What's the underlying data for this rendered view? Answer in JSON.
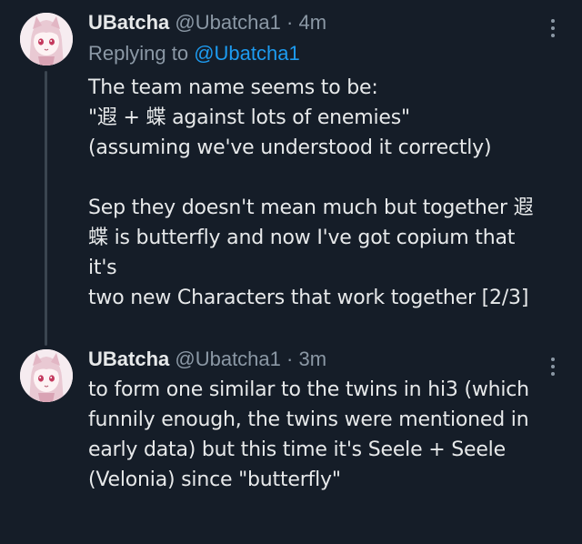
{
  "tweets": [
    {
      "name": "UBatcha",
      "handle": "@Ubatcha1",
      "separator": "·",
      "time": "4m",
      "replying_prefix": "Replying to",
      "replying_to": "@Ubatcha1",
      "paragraph1": "The team name seems to be:\n\"遐 + 蝶 against lots of enemies\"\n(assuming we've understood it correctly)",
      "paragraph2": "Sep they doesn't mean much but together 遐\n蝶 is butterfly and now I've got copium that it's\ntwo new Characters that work together [2/3]"
    },
    {
      "name": "UBatcha",
      "handle": "@Ubatcha1",
      "separator": "·",
      "time": "3m",
      "text": "to form one similar to the twins in hi3 (which\nfunnily enough, the twins were mentioned in\nearly data) but this time it's Seele + Seele\n(Velonia) since \"butterfly\""
    }
  ],
  "icons": {
    "avatar": "anime-avatar-icon",
    "more": "more-options-icon"
  },
  "colors": {
    "background": "#151d28",
    "text": "#e7e9ea",
    "muted": "#8b98a5",
    "link": "#1d9bf0"
  }
}
